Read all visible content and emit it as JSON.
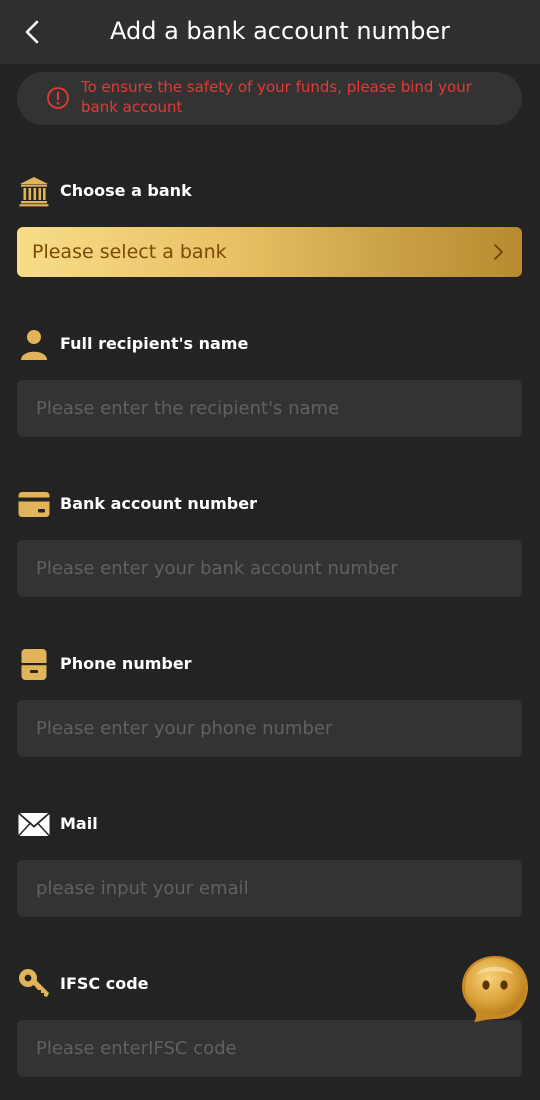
{
  "header": {
    "title": "Add a bank account number",
    "back_icon": "chevron-left-icon"
  },
  "notice": {
    "icon": "alert-circle-icon",
    "text": "To ensure the safety of your funds, please bind your bank account",
    "color": "#e53935"
  },
  "bank": {
    "label": "Choose a bank",
    "icon": "bank-icon",
    "select_text": "Please select a bank"
  },
  "recipient": {
    "label": "Full recipient's name",
    "icon": "person-icon",
    "placeholder": "Please enter the recipient's name"
  },
  "account": {
    "label": "Bank account number",
    "icon": "card-icon",
    "placeholder": "Please enter your bank account number"
  },
  "phone": {
    "label": "Phone number",
    "icon": "phone-icon",
    "placeholder": "Please enter your phone number"
  },
  "mail": {
    "label": "Mail",
    "icon": "envelope-icon",
    "placeholder": "please input your email"
  },
  "ifsc": {
    "label": "IFSC code",
    "icon": "key-icon",
    "placeholder": "Please enterIFSC code"
  },
  "floating_button": {
    "icon": "chat-mascot-icon"
  },
  "colors": {
    "background": "#232323",
    "header": "#2f2f2f",
    "field": "#333333",
    "accent_gold": "#e8be63",
    "icon_gold": "#e2b45a"
  }
}
